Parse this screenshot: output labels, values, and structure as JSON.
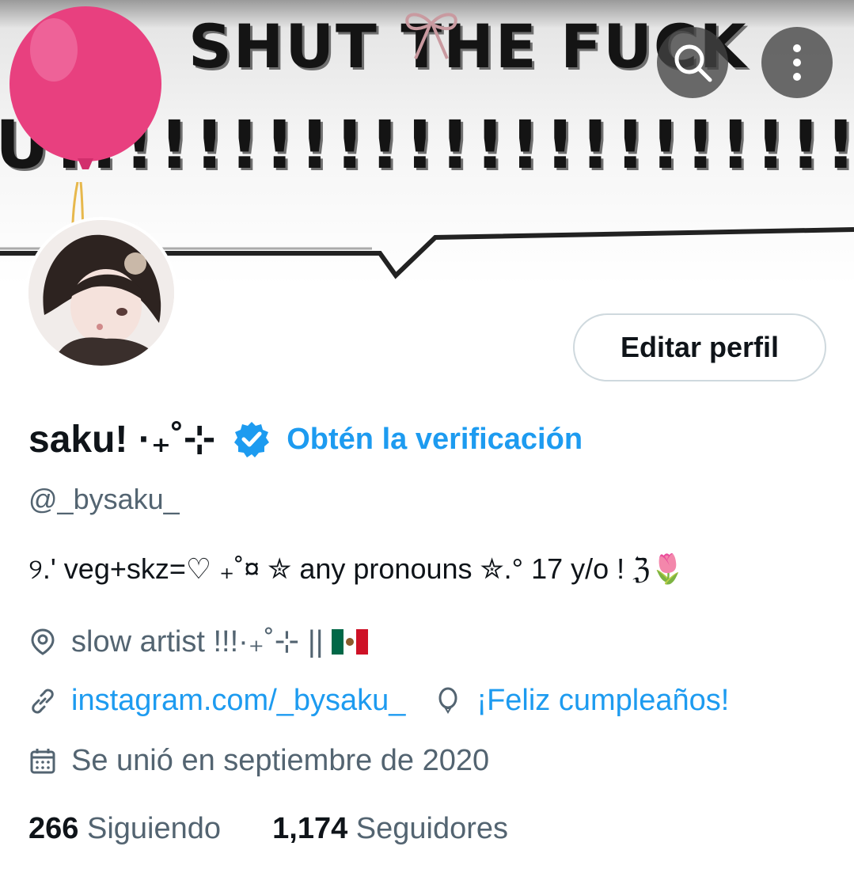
{
  "banner": {
    "line1": "SHUT THE FUCK",
    "line2": "U!!!!!!!!!!!!!!!!!!!!!!!!!!!!!!!!!!!!!"
  },
  "header": {
    "search_icon": "search-icon",
    "more_icon": "more-vertical-icon"
  },
  "profile": {
    "edit_label": "Editar perfil",
    "display_name": "saku! ·₊˚⊹",
    "verify_label": "Obtén la verificación",
    "handle": "@_bysaku_",
    "bio": "୨.' veg+skz=♡ ₊˚¤  ✮ any pronouns ✮.° 17 y/o ! ℨ🌷",
    "location": "slow artist !!!·₊˚⊹ ||",
    "website": "instagram.com/_bysaku_",
    "birthday": "¡Feliz cumpleaños!",
    "joined": "Se unió en septiembre de 2020"
  },
  "stats": {
    "following_count": "266",
    "following_label": "Siguiendo",
    "followers_count": "1,174",
    "followers_label": "Seguidores"
  },
  "colors": {
    "accent": "#1d9bf0",
    "balloon": "#e8407f",
    "text_primary": "#0f1419",
    "text_secondary": "#536471"
  }
}
